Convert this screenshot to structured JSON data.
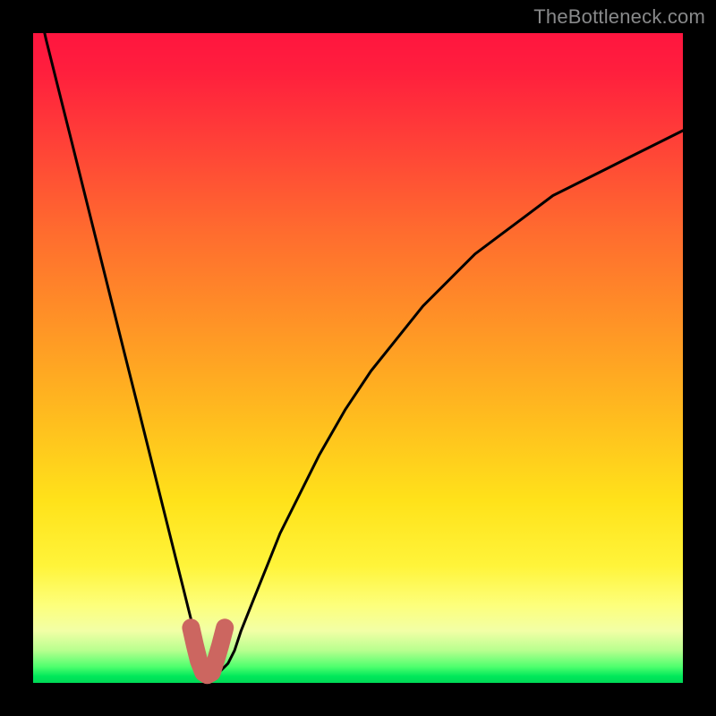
{
  "watermark": "TheBottleneck.com",
  "chart_data": {
    "type": "line",
    "title": "",
    "xlabel": "",
    "ylabel": "",
    "xlim": [
      0,
      100
    ],
    "ylim": [
      0,
      100
    ],
    "series": [
      {
        "name": "curve",
        "x": [
          0,
          2,
          4,
          6,
          8,
          10,
          12,
          14,
          16,
          18,
          20,
          22,
          23,
          24,
          25,
          26,
          27,
          28,
          29,
          30,
          31,
          32,
          34,
          36,
          38,
          40,
          44,
          48,
          52,
          56,
          60,
          64,
          68,
          72,
          76,
          80,
          84,
          88,
          92,
          96,
          100
        ],
        "values": [
          108,
          99,
          91,
          83,
          75,
          67,
          59,
          51,
          43,
          35,
          27,
          19,
          15,
          11,
          7,
          2,
          1,
          1,
          2,
          3,
          5,
          8,
          13,
          18,
          23,
          27,
          35,
          42,
          48,
          53,
          58,
          62,
          66,
          69,
          72,
          75,
          77,
          79,
          81,
          83,
          85
        ]
      }
    ],
    "highlight": {
      "name": "bottom-u-marker",
      "color": "#cc6660",
      "x": [
        24.3,
        24.9,
        25.5,
        26.2,
        26.8,
        27.5,
        28.1,
        28.8,
        29.5
      ],
      "values": [
        8.5,
        5.8,
        3.4,
        1.6,
        1.2,
        1.6,
        3.4,
        5.8,
        8.5
      ]
    }
  }
}
